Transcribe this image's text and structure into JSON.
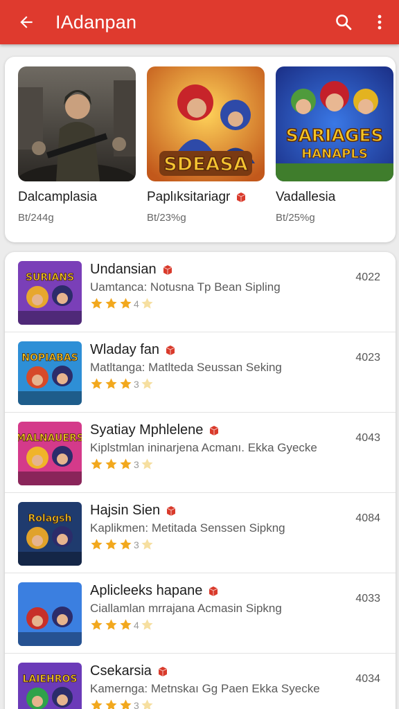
{
  "appbar": {
    "title": "IAdanpan",
    "back_icon": "arrow-left-icon",
    "search_icon": "search-icon",
    "more_icon": "more-vert-icon",
    "color": "#df3a2e"
  },
  "featured": [
    {
      "name": "Dalcamplasia",
      "sub": "Bt/244g",
      "badge": false,
      "art": "soldier-art"
    },
    {
      "name": "Paplıksitariagr",
      "sub": "Bt/23%g",
      "badge": true,
      "art": "ninja-art"
    },
    {
      "name": "Vadallesia",
      "sub": "Bt/25%g",
      "badge": false,
      "art": "cartoon-army-art"
    }
  ],
  "featured_art_text": [
    "SDEASA",
    "SARIAGES",
    "HANAPLS"
  ],
  "list": [
    {
      "name": "Undansian",
      "desc": "Uamtanca: Notusna Tp Bean Sipling",
      "rating": 4,
      "num": "4022",
      "icon_text": "SURIANS"
    },
    {
      "name": "Wladay fan",
      "desc": "Matltanga: Matlteda Seussan Seking",
      "rating": 3,
      "num": "4023",
      "icon_text": "NOPIABAS"
    },
    {
      "name": "Syatiay Mphlelene",
      "desc": "Kiplstmlan ininarjena Acmanı. Ekka Gyecke",
      "rating": 3,
      "num": "4043",
      "icon_text": "MALNAUERS"
    },
    {
      "name": "Hajsin Sien",
      "desc": "Kaplikmen: Metitada Senssen Sipkng",
      "rating": 3,
      "num": "4084",
      "icon_text": "Rolagsh"
    },
    {
      "name": "Aplicleeks hapane",
      "desc": "Ciallamlan mrrajana Acmasin Sipkng",
      "rating": 4,
      "num": "4033",
      "icon_text": ""
    },
    {
      "name": "Csekarsia",
      "desc": "Kamernga: Metnskaı Gg Paen Ekka Syecke",
      "rating": 3,
      "num": "4034",
      "icon_text": "LAIEHROS"
    }
  ],
  "colors": {
    "accent": "#df3a2e",
    "star": "#f2a81d",
    "badge": "#d93a2b"
  }
}
